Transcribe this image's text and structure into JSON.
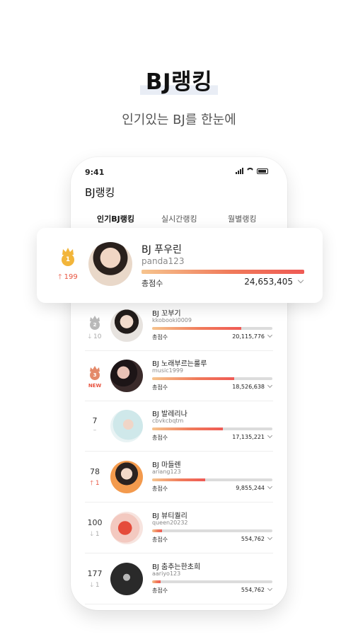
{
  "hero": {
    "title": "BJ랭킹",
    "subtitle": "인기있는 BJ를 한눈에"
  },
  "status_bar": {
    "time": "9:41"
  },
  "app": {
    "title": "BJ랭킹"
  },
  "tabs": [
    {
      "label": "인기BJ랭킹",
      "active": true
    },
    {
      "label": "실시간랭킹",
      "active": false
    },
    {
      "label": "월별랭킹",
      "active": false
    }
  ],
  "score_label": "총점수",
  "featured": {
    "rank": "1",
    "change": "199",
    "trend": "up",
    "name": "BJ 푸우린",
    "id": "panda123",
    "score": "24,653,405",
    "progress": 1.0
  },
  "list": [
    {
      "rank": "2",
      "crown": "silver",
      "change": "10",
      "trend": "down",
      "name": "BJ 꼬부기",
      "id": "kkobooki0009",
      "score": "20,115,776",
      "progress": 0.74
    },
    {
      "rank": "3",
      "crown": "bronze",
      "change": "NEW",
      "trend": "new",
      "name": "BJ 노래부르는룰루",
      "id": "music1999",
      "score": "18,526,638",
      "progress": 0.68
    },
    {
      "rank": "7",
      "crown": "",
      "change": "–",
      "trend": "same",
      "name": "BJ 발레리나",
      "id": "cbvkcbqtm",
      "score": "17,135,221",
      "progress": 0.59
    },
    {
      "rank": "78",
      "crown": "",
      "change": "1",
      "trend": "up",
      "name": "BJ 마들렌",
      "id": "ariang123",
      "score": "9,855,244",
      "progress": 0.44
    },
    {
      "rank": "100",
      "crown": "",
      "change": "1",
      "trend": "down",
      "name": "BJ 뷰티퀄리",
      "id": "queen20232",
      "score": "554,762",
      "progress": 0.08
    },
    {
      "rank": "177",
      "crown": "",
      "change": "1",
      "trend": "down",
      "name": "BJ 춤추는한초희",
      "id": "aariyo123",
      "score": "554,762",
      "progress": 0.07
    }
  ],
  "colors": {
    "accent": "#ef5a55",
    "gold": "#f2b53a",
    "silver": "#b9b9b9",
    "bronze": "#e48a6a",
    "bar_bg": "#dcdcdc"
  }
}
